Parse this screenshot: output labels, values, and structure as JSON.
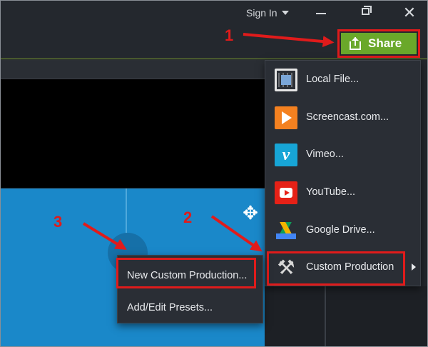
{
  "titlebar": {
    "signin_label": "Sign In",
    "minimize_label": "",
    "close_label": "✕"
  },
  "share_button": {
    "label": "Share"
  },
  "share_menu": {
    "items": [
      {
        "label": "Local File...",
        "icon": "film-icon"
      },
      {
        "label": "Screencast.com...",
        "icon": "screencast-icon"
      },
      {
        "label": "Vimeo...",
        "icon": "vimeo-icon",
        "glyph": "v"
      },
      {
        "label": "YouTube...",
        "icon": "youtube-icon"
      },
      {
        "label": "Google Drive...",
        "icon": "google-drive-icon"
      },
      {
        "label": "Custom Production",
        "icon": "tools-icon",
        "glyph": "⚒"
      }
    ]
  },
  "submenu": {
    "items": [
      {
        "label": "New Custom Production..."
      },
      {
        "label": "Add/Edit Presets..."
      }
    ]
  },
  "annotations": {
    "step1": "1",
    "step2": "2",
    "step3": "3"
  },
  "move_cursor": "✥",
  "colors": {
    "share_green": "#6aa82a",
    "highlight_red": "#e01b1b",
    "canvas_blue": "#1a88c9"
  }
}
